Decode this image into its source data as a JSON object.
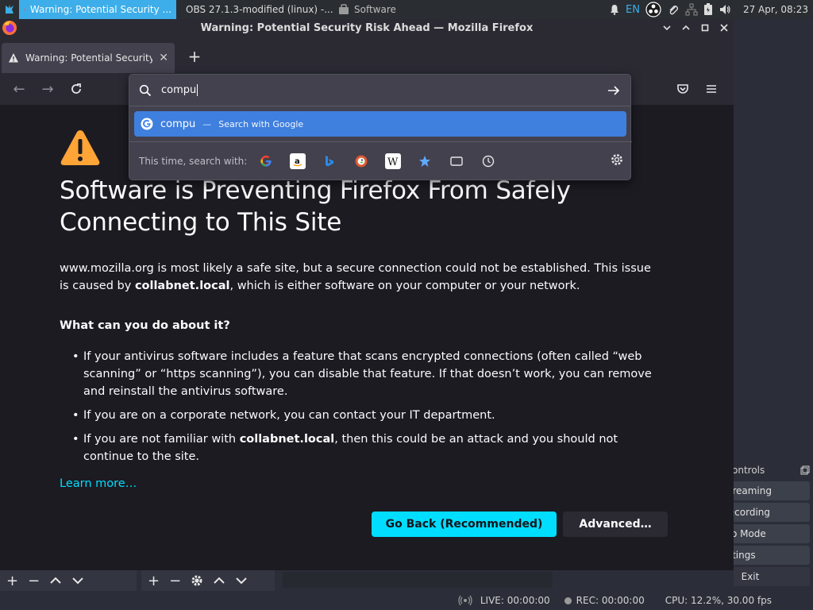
{
  "taskbar": {
    "tasks": [
      {
        "label": "Warning: Potential Security ...",
        "active": true
      },
      {
        "label": "OBS 27.1.3-modified (linux) -...",
        "active": false
      },
      {
        "label": "Software",
        "active": false
      }
    ],
    "keyboard_layout": "EN",
    "clock": "27 Apr, 08:23"
  },
  "firefox": {
    "window_title": "Warning: Potential Security Risk Ahead — Mozilla Firefox",
    "tab_label": "Warning: Potential Security Ri",
    "urlbar": {
      "typed_text": "compu",
      "suggestion_text": "compu",
      "suggestion_separator": "—",
      "suggestion_engine": "Search with Google",
      "search_with_label": "This time, search with:",
      "engines": [
        "google-icon",
        "amazon-icon",
        "bing-icon",
        "duckduckgo-icon",
        "wikipedia-icon",
        "bookmarks-icon",
        "tabs-icon",
        "history-icon"
      ]
    },
    "error_page": {
      "title_line1": "Software is Preventing Firefox From Safely",
      "title_line2": "Connecting to This Site",
      "intro_pre": "www.mozilla.org is most likely a safe site, but a secure connection could not be established. This issue is caused by ",
      "intro_bold": "collabnet.local",
      "intro_post": ", which is either software on your computer or your network.",
      "question": "What can you do about it?",
      "bullets": [
        {
          "pre": "If your antivirus software includes a feature that scans encrypted connections (often called “web scanning” or “https scanning”), you can disable that feature. If that doesn’t work, you can remove and reinstall the antivirus software.",
          "bold": "",
          "post": ""
        },
        {
          "pre": "If you are on a corporate network, you can contact your IT department.",
          "bold": "",
          "post": ""
        },
        {
          "pre": "If you are not familiar with ",
          "bold": "collabnet.local",
          "post": ", then this could be an attack and you should not continue to the site."
        }
      ],
      "learn_more": "Learn more…",
      "go_back_button": "Go Back (Recommended)",
      "advanced_button": "Advanced…"
    }
  },
  "obs": {
    "controls_title": "ontrols",
    "buttons": [
      "Streaming",
      "Recording",
      "dio Mode",
      "ettings"
    ],
    "exit_button": "Exit",
    "status": {
      "live": "LIVE: 00:00:00",
      "rec": "REC: 00:00:00",
      "cpu": "CPU: 12.2%, 30.00 fps"
    }
  },
  "colors": {
    "accent": "#3daee9",
    "link": "#00ddff",
    "primary_button": "#00ddff",
    "warning": "#ffa436",
    "suggestion_highlight": "#3f7fde"
  }
}
